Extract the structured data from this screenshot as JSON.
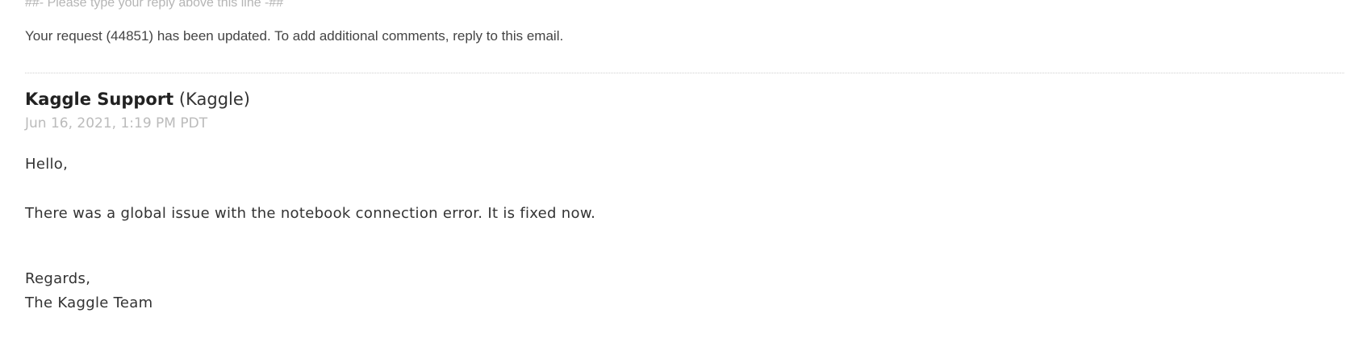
{
  "email": {
    "reply_marker": "##- Please type your reply above this line -##",
    "update_notice": "Your request (44851) has been updated. To add additional comments, reply to this email.",
    "comment": {
      "author_name": "Kaggle Support",
      "author_org": "(Kaggle)",
      "timestamp": "Jun 16, 2021, 1:19 PM PDT",
      "greeting": "Hello,",
      "message": "There was a global issue with the notebook connection error. It is fixed now.",
      "closing": "Regards,",
      "signature": "The Kaggle Team"
    }
  }
}
